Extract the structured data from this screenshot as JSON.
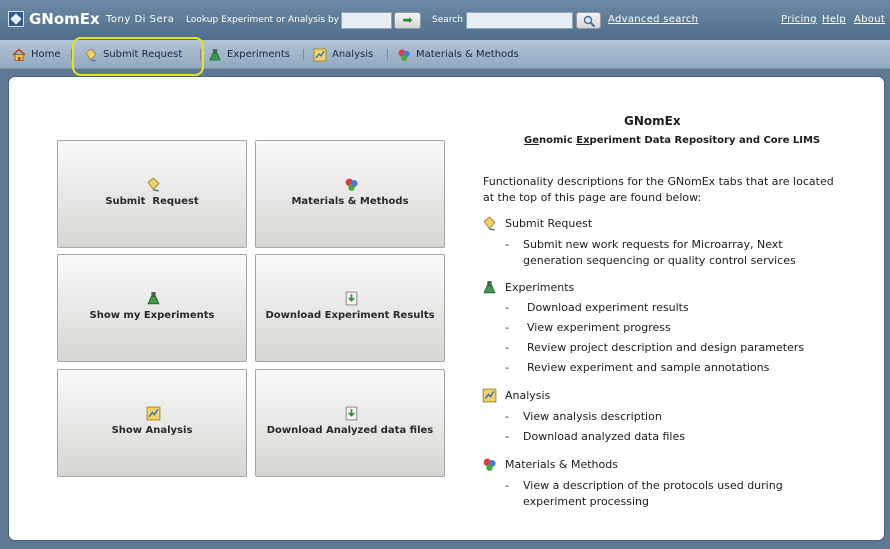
{
  "app": {
    "name": "GNomEx",
    "user": "Tony Di Sera",
    "lookup_label": "Lookup Experiment or Analysis by #",
    "lookup_value": "",
    "go_arrow": "➡",
    "search_label": "Search",
    "search_value": "",
    "advanced_search": "Advanced search",
    "links": [
      "Pricing",
      "Help",
      "About"
    ]
  },
  "tabs": [
    {
      "label": "Home",
      "icon": "home-icon"
    },
    {
      "label": "Submit Request",
      "icon": "submit-icon"
    },
    {
      "label": "Experiments",
      "icon": "flask-icon"
    },
    {
      "label": "Analysis",
      "icon": "analysis-icon"
    },
    {
      "label": "Materials & Methods",
      "icon": "materials-icon"
    }
  ],
  "tiles": [
    {
      "label": "Submit  Request",
      "icon": "submit-icon"
    },
    {
      "label": "Materials & Methods",
      "icon": "materials-icon"
    },
    {
      "label": "Show my Experiments",
      "icon": "flask-icon"
    },
    {
      "label": "Download Experiment Results",
      "icon": "download-icon"
    },
    {
      "label": "Show Analysis",
      "icon": "analysis-icon"
    },
    {
      "label": "Download Analyzed data files",
      "icon": "download-icon"
    }
  ],
  "info": {
    "title": "GNomEx",
    "subtitle": {
      "p1": "Ge",
      "p2": "nomic ",
      "p3": "Ex",
      "p4": "periment Data Repository and Core LIMS"
    },
    "intro": "Functionality descriptions for the GNomEx tabs that are located at the top of this page are found below:",
    "sections": [
      {
        "title": "Submit Request",
        "icon": "submit-icon",
        "bullets": [
          "Submit new work requests for Microarray, Next generation sequencing or quality control services"
        ]
      },
      {
        "title": "Experiments",
        "icon": "flask-icon",
        "bullets": [
          "Download experiment results",
          "View experiment progress",
          "Review project description and design parameters",
          "Review experiment and sample annotations"
        ]
      },
      {
        "title": "Analysis",
        "icon": "analysis-icon",
        "bullets": [
          "View analysis description",
          "Download analyzed data files"
        ]
      },
      {
        "title": "Materials & Methods",
        "icon": "materials-icon",
        "bullets": [
          "View a description of the protocols used during experiment processing"
        ]
      }
    ]
  },
  "colors": {
    "topbar": "#5a7896",
    "tabbar": "#a2b7cb",
    "highlight": "#e5e224",
    "frame": "#5e7894"
  }
}
